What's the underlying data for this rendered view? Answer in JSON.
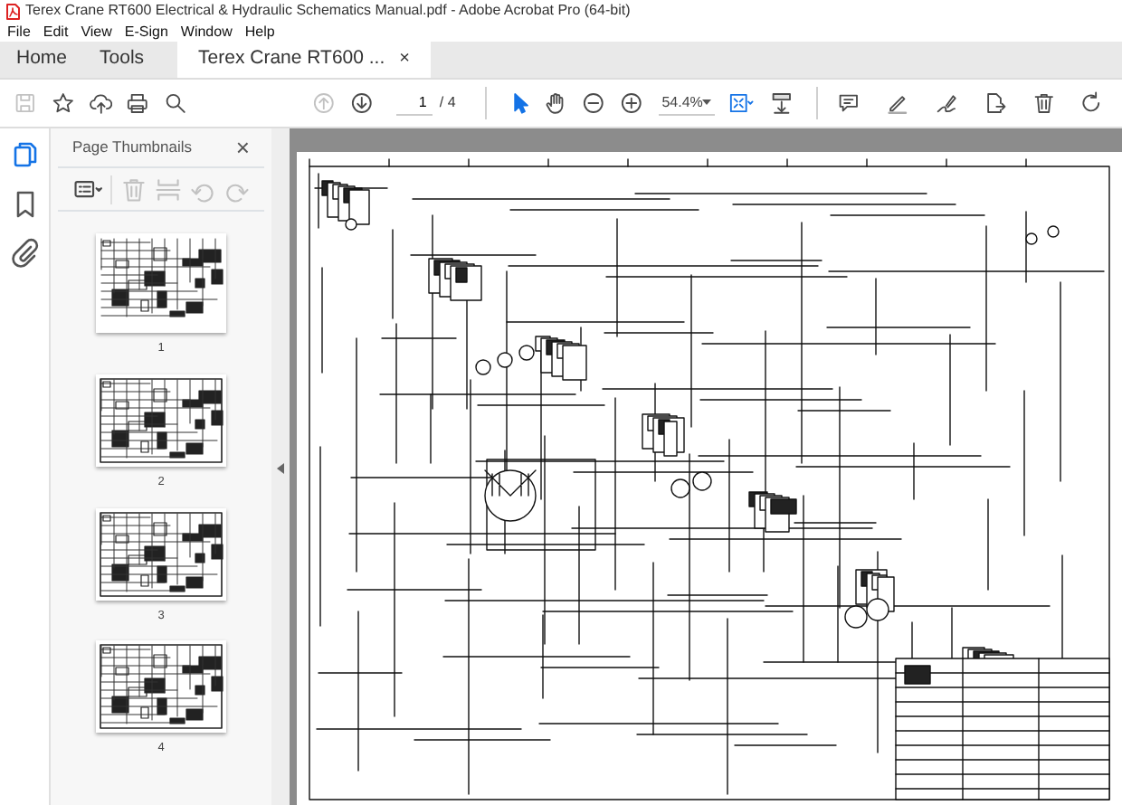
{
  "window": {
    "title": "Terex Crane RT600 Electrical & Hydraulic Schematics Manual.pdf - Adobe Acrobat Pro (64-bit)"
  },
  "menu": [
    "File",
    "Edit",
    "View",
    "E-Sign",
    "Window",
    "Help"
  ],
  "tabs": [
    {
      "label": "Home",
      "selected": false
    },
    {
      "label": "Tools",
      "selected": false
    },
    {
      "label": "Terex Crane RT600 ...",
      "selected": true,
      "close": "×"
    }
  ],
  "toolbar": {
    "groups": [
      {
        "items": [
          {
            "kind": "save",
            "disabled": true,
            "selected": false
          },
          {
            "kind": "star",
            "disabled": false,
            "selected": false
          },
          {
            "kind": "upload",
            "disabled": false,
            "selected": false
          },
          {
            "kind": "print",
            "disabled": false,
            "selected": false
          },
          {
            "kind": "search",
            "disabled": false,
            "selected": false
          }
        ]
      },
      {
        "items": [
          {
            "kind": "page-up",
            "disabled": true,
            "selected": false
          },
          {
            "kind": "page-down",
            "disabled": false,
            "selected": false
          },
          {
            "kind": "page",
            "value": "1",
            "total": "/ 4",
            "disabled": false,
            "selected": false
          },
          {
            "kind": "select",
            "disabled": false,
            "selected": true
          },
          {
            "kind": "hand",
            "disabled": false,
            "selected": false
          },
          {
            "kind": "zoom-out",
            "disabled": false,
            "selected": false
          },
          {
            "kind": "zoom-in",
            "disabled": false,
            "selected": false
          },
          {
            "kind": "zoom",
            "value": "54.4%",
            "disabled": false,
            "selected": false
          },
          {
            "kind": "fit",
            "disabled": false,
            "selected": false
          },
          {
            "kind": "scroll",
            "disabled": false,
            "selected": false
          }
        ]
      },
      {
        "items": [
          {
            "kind": "comment",
            "disabled": false,
            "selected": false
          },
          {
            "kind": "highlight",
            "disabled": false,
            "selected": false
          },
          {
            "kind": "sign",
            "disabled": false,
            "selected": false
          },
          {
            "kind": "export",
            "disabled": false,
            "selected": false
          },
          {
            "kind": "delete",
            "disabled": false,
            "selected": false
          },
          {
            "kind": "rotate",
            "disabled": false,
            "selected": false
          }
        ]
      }
    ]
  },
  "side_rail": [
    {
      "kind": "pages",
      "selected": true
    },
    {
      "kind": "bookmark",
      "selected": false
    },
    {
      "kind": "attachment",
      "selected": false
    }
  ],
  "thumbnails_panel": {
    "title": "Page Thumbnails",
    "close": "×",
    "tools": [
      {
        "kind": "options",
        "disabled": false
      },
      {
        "kind": "delete",
        "disabled": true
      },
      {
        "kind": "split",
        "disabled": true
      },
      {
        "kind": "undo",
        "disabled": true
      },
      {
        "kind": "redo",
        "disabled": true
      }
    ],
    "pages": [
      {
        "label": "1"
      },
      {
        "label": "2"
      },
      {
        "label": "3"
      },
      {
        "label": "4"
      }
    ]
  }
}
